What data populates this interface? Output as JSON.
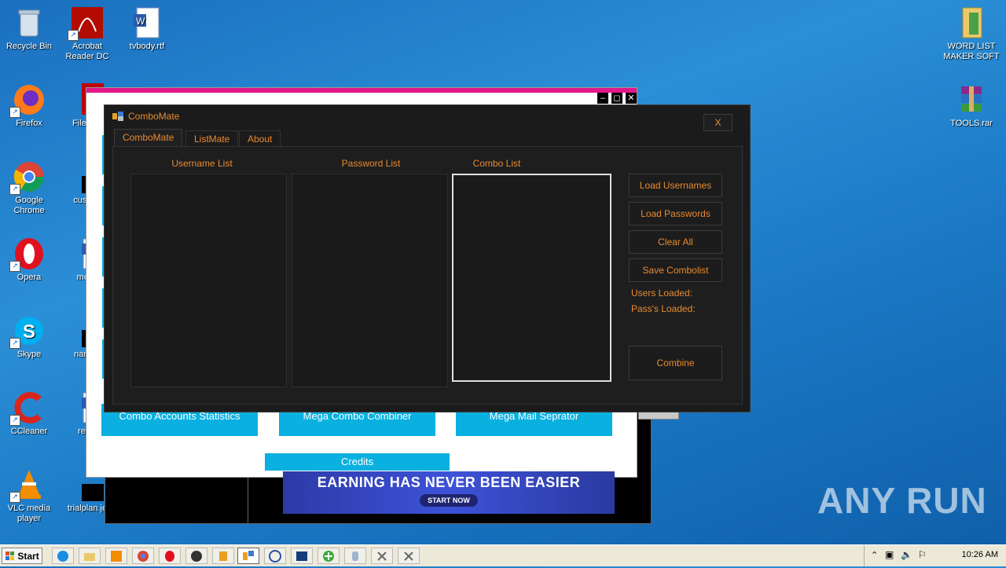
{
  "desktop": {
    "icons_left": [
      {
        "label": "Recycle Bin",
        "icon": "recycle-bin-icon"
      },
      {
        "label": "Acrobat Reader DC",
        "icon": "acrobat-icon"
      },
      {
        "label": "tvbody.rtf",
        "icon": "word-doc-icon"
      },
      {
        "label": "Firefox",
        "icon": "firefox-icon"
      },
      {
        "label": "FileZilla",
        "icon": "filezilla-icon"
      },
      {
        "label": "Google Chrome",
        "icon": "chrome-icon"
      },
      {
        "label": "custom",
        "icon": "black-file-icon"
      },
      {
        "label": "Opera",
        "icon": "opera-icon"
      },
      {
        "label": "melat",
        "icon": "word-doc-icon"
      },
      {
        "label": "Skype",
        "icon": "skype-icon"
      },
      {
        "label": "namep",
        "icon": "black-file-icon"
      },
      {
        "label": "CCleaner",
        "icon": "ccleaner-icon"
      },
      {
        "label": "reply",
        "icon": "word-doc-icon"
      },
      {
        "label": "VLC media player",
        "icon": "vlc-icon"
      },
      {
        "label": "trialplan.je",
        "icon": "black-file-icon"
      }
    ],
    "icons_right": [
      {
        "label": "WORD LIST MAKER SOFT",
        "icon": "folder-icon"
      },
      {
        "label": "TOOLS.rar",
        "icon": "winrar-icon"
      }
    ]
  },
  "bg_window": {
    "buttons": [
      "Combo Accounts Statistics",
      "Mega Combo Combiner",
      "Mega Mail Seprator"
    ],
    "credits": "Credits",
    "banner_title": "EARNING HAS NEVER BEEN EASIER",
    "banner_button": "START NOW",
    "controls": {
      "minimize": "–",
      "maximize": "◻",
      "close": "✕"
    }
  },
  "combomate": {
    "title": "ComboMate",
    "close": "X",
    "tabs": [
      "ComboMate",
      "ListMate",
      "About"
    ],
    "active_tab": "ComboMate",
    "lists": {
      "username_label": "Username List",
      "password_label": "Password List",
      "combo_label": "Combo List"
    },
    "buttons": {
      "load_usernames": "Load Usernames",
      "load_passwords": "Load Passwords",
      "clear_all": "Clear All",
      "save_combolist": "Save Combolist",
      "combine": "Combine"
    },
    "stats": {
      "users_loaded": "Users Loaded:",
      "pass_loaded": "Pass's Loaded:"
    },
    "accent_color": "#e98a2f"
  },
  "taskbar": {
    "start_label": "Start",
    "clock": "10:26 AM",
    "pinned": [
      "ie-icon",
      "explorer-icon",
      "media-icon",
      "chrome-icon",
      "opera-icon",
      "app-icon",
      "user-icon",
      "combomate-icon",
      "network-icon",
      "window-icon",
      "green-plus-icon",
      "keyboard-icon",
      "tool-icon",
      "tool-icon"
    ]
  },
  "watermark": "ANY RUN"
}
